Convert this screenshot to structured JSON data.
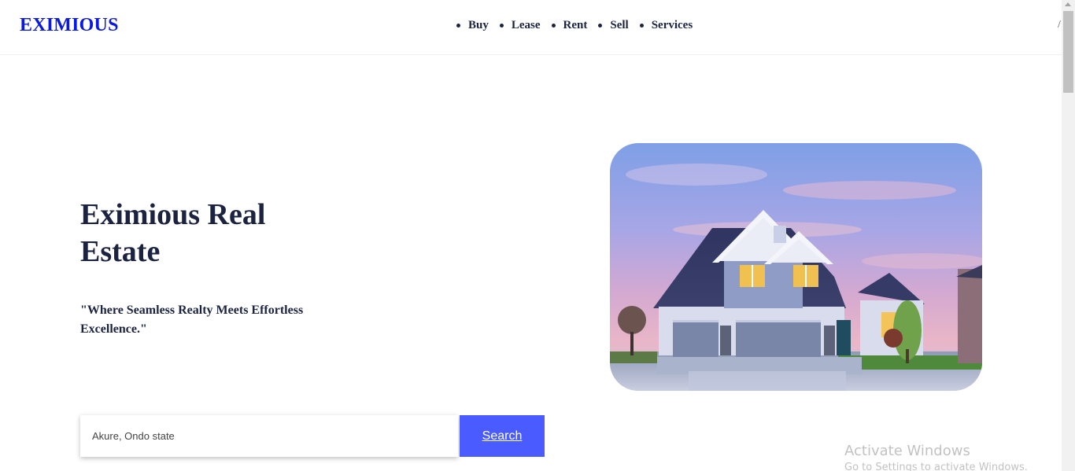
{
  "brand": {
    "logo": "EXIMIOUS",
    "logo_color": "#0a19e0"
  },
  "nav": {
    "items": [
      {
        "label": "Buy"
      },
      {
        "label": "Lease"
      },
      {
        "label": "Rent"
      },
      {
        "label": "Sell"
      },
      {
        "label": "Services"
      }
    ],
    "extra": "/"
  },
  "hero": {
    "title": "Eximious Real Estate",
    "tagline": "\"Where Seamless Realty Meets Effortless Excellence.\"",
    "image_icon": "house-photo"
  },
  "search": {
    "value": "Akure, Ondo state",
    "button_label": "Search",
    "button_color": "#4a5cff"
  },
  "watermark": {
    "title": "Activate Windows",
    "subtitle": "Go to Settings to activate Windows."
  },
  "colors": {
    "heading": "#1b2340",
    "accent": "#4a5cff"
  }
}
